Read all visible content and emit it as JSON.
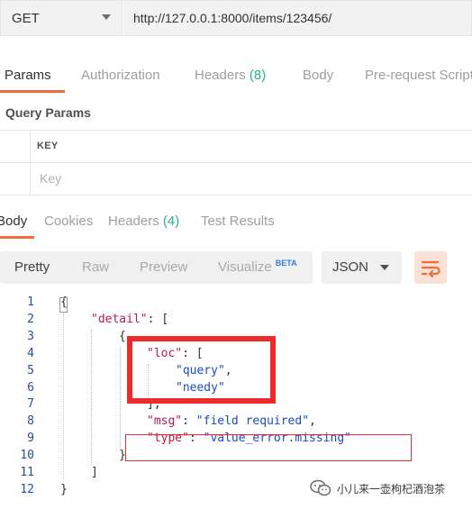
{
  "request": {
    "method": "GET",
    "url": "http://127.0.0.1:8000/items/123456/"
  },
  "request_tabs": [
    {
      "label": "Params",
      "count": ""
    },
    {
      "label": "Authorization",
      "count": ""
    },
    {
      "label": "Headers",
      "count": "(8)"
    },
    {
      "label": "Body",
      "count": ""
    },
    {
      "label": "Pre-request Script",
      "count": ""
    }
  ],
  "query_params": {
    "title": "Query Params",
    "column_key": "KEY",
    "key_placeholder": "Key"
  },
  "response_tabs": [
    {
      "label": "Body",
      "count": ""
    },
    {
      "label": "Cookies",
      "count": ""
    },
    {
      "label": "Headers",
      "count": "(4)"
    },
    {
      "label": "Test Results",
      "count": ""
    }
  ],
  "view_modes": {
    "pretty": "Pretty",
    "raw": "Raw",
    "preview": "Preview",
    "visualize": "Visualize",
    "beta": "BETA"
  },
  "format": "JSON",
  "code_lines": [
    {
      "no": "1",
      "parts": [
        {
          "t": "p",
          "v": "{"
        }
      ]
    },
    {
      "no": "2",
      "parts": [
        {
          "t": "k",
          "v": "\"detail\""
        },
        {
          "t": "p",
          "v": ": ["
        }
      ]
    },
    {
      "no": "3",
      "parts": [
        {
          "t": "p",
          "v": "{"
        }
      ]
    },
    {
      "no": "4",
      "parts": [
        {
          "t": "k",
          "v": "\"loc\""
        },
        {
          "t": "p",
          "v": ": ["
        }
      ]
    },
    {
      "no": "5",
      "parts": [
        {
          "t": "s",
          "v": "\"query\""
        },
        {
          "t": "p",
          "v": ","
        }
      ]
    },
    {
      "no": "6",
      "parts": [
        {
          "t": "s",
          "v": "\"needy\""
        }
      ]
    },
    {
      "no": "7",
      "parts": [
        {
          "t": "p",
          "v": "],"
        }
      ]
    },
    {
      "no": "8",
      "parts": [
        {
          "t": "k",
          "v": "\"msg\""
        },
        {
          "t": "p",
          "v": ": "
        },
        {
          "t": "s",
          "v": "\"field required\""
        },
        {
          "t": "p",
          "v": ","
        }
      ]
    },
    {
      "no": "9",
      "parts": [
        {
          "t": "k",
          "v": "\"type\""
        },
        {
          "t": "p",
          "v": ": "
        },
        {
          "t": "s",
          "v": "\"value_error.missing\""
        }
      ]
    },
    {
      "no": "10",
      "parts": [
        {
          "t": "p",
          "v": "}"
        }
      ]
    },
    {
      "no": "11",
      "parts": [
        {
          "t": "p",
          "v": "]"
        }
      ]
    },
    {
      "no": "12",
      "parts": [
        {
          "t": "p",
          "v": "}"
        }
      ]
    }
  ],
  "colors": {
    "accent": "#f26b3a",
    "count": "#26b47f",
    "json_key": "#b3204a",
    "json_string": "#1b4cc2",
    "line_number": "#2a4e9c",
    "highlight": "#ee2a2a"
  },
  "watermark": "小儿来一壶枸杞酒泡茶"
}
